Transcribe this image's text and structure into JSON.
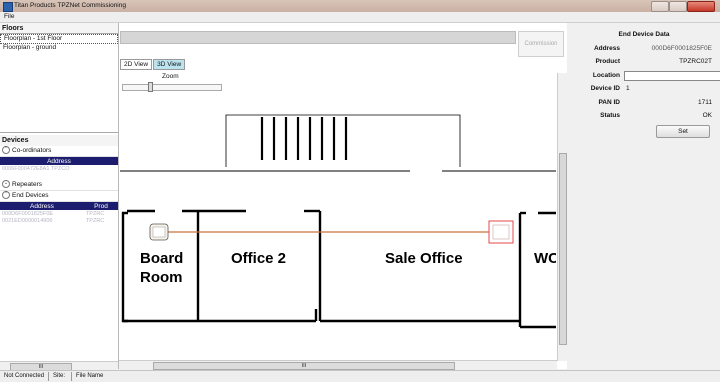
{
  "window": {
    "title": "Titan Products TPZNet Commissioning"
  },
  "menu": {
    "file": "File"
  },
  "floors": {
    "header": "Floors",
    "items": [
      "Floorplan - 1st Floor",
      "Floorplan - ground"
    ]
  },
  "devices": {
    "header": "Devices",
    "coordinators": {
      "label": "Co-ordinators",
      "columns": [
        "Address"
      ],
      "rows": [
        [
          "0006F000472E8A1 TPZCO"
        ]
      ]
    },
    "repeaters": {
      "label": "Repeaters"
    },
    "end_devices": {
      "label": "End Devices",
      "columns": [
        "Address",
        "Prod"
      ],
      "rows": [
        [
          "000D6F0001825F0E",
          "TPZRC"
        ],
        [
          "0021ED0000014906",
          "TPZRC"
        ]
      ]
    }
  },
  "center": {
    "commission_label": "Commission",
    "tabs": [
      "2D View",
      "3D View"
    ],
    "zoom_label": "Zoom",
    "rooms": [
      "Board",
      "Room",
      "Office 2",
      "Sale Office",
      "WC"
    ]
  },
  "scroll_glyph": "III",
  "end_device": {
    "title": "End Device Data",
    "fields": {
      "address": {
        "label": "Address",
        "value": "000D6F0001825F0E"
      },
      "product": {
        "label": "Product",
        "value": "TPZRC02T"
      },
      "location": {
        "label": "Location",
        "value": ""
      },
      "device_id": {
        "label": "Device ID",
        "value": "1"
      },
      "pan_id": {
        "label": "PAN ID",
        "value": "1711"
      },
      "status": {
        "label": "Status",
        "value": "OK"
      }
    },
    "set_label": "Set"
  },
  "status_bar": {
    "connection": "Not Connected",
    "site": "Site:",
    "file": "File Name"
  },
  "colors": {
    "header_blue": "#1c1d6e",
    "link_line": "#c9753a",
    "selected_device": "#e04a4a"
  }
}
